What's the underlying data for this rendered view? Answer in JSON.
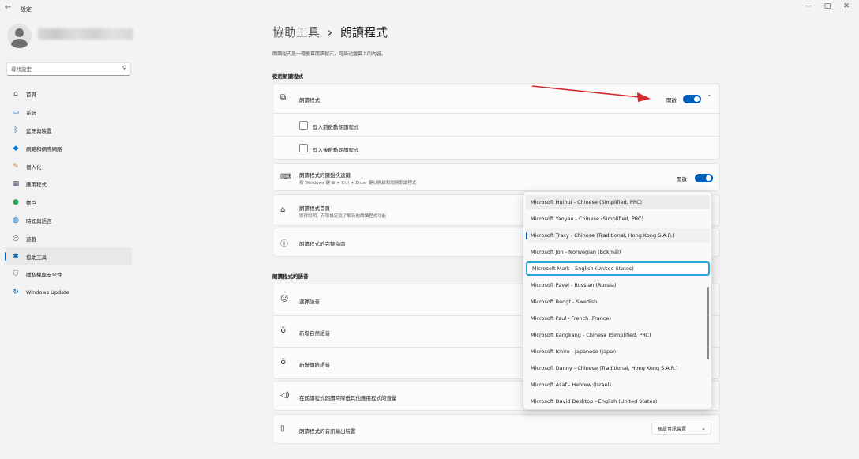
{
  "window": {
    "title": "設定",
    "controls": [
      "—",
      "▢",
      "✕"
    ]
  },
  "user": {
    "name": ""
  },
  "search": {
    "placeholder": "尋找設定"
  },
  "nav": [
    {
      "label": "首頁",
      "icon": "home-icon",
      "glyph": "⌂",
      "color": "#555555"
    },
    {
      "label": "系統",
      "icon": "system-icon",
      "glyph": "▭",
      "color": "#0067c0"
    },
    {
      "label": "藍牙與裝置",
      "icon": "bluetooth-icon",
      "glyph": "ᛒ",
      "color": "#0067c0"
    },
    {
      "label": "網路和網際網路",
      "icon": "network-icon",
      "glyph": "◆",
      "color": "#0078d4"
    },
    {
      "label": "個人化",
      "icon": "brush-icon",
      "glyph": "✎",
      "color": "#d87a1c"
    },
    {
      "label": "應用程式",
      "icon": "apps-icon",
      "glyph": "▦",
      "color": "#4a5568"
    },
    {
      "label": "帳戶",
      "icon": "account-icon",
      "glyph": "●",
      "color": "#2e9d5a"
    },
    {
      "label": "時間與語言",
      "icon": "globe-time-icon",
      "glyph": "◍",
      "color": "#0078d4"
    },
    {
      "label": "遊戲",
      "icon": "gamepad-icon",
      "glyph": "◎",
      "color": "#666666"
    },
    {
      "label": "協助工具",
      "icon": "accessibility-icon",
      "glyph": "✱",
      "color": "#0067c0",
      "active": true
    },
    {
      "label": "隱私權與安全性",
      "icon": "shield-icon",
      "glyph": "⛉",
      "color": "#707070"
    },
    {
      "label": "Windows Update",
      "icon": "update-icon",
      "glyph": "↻",
      "color": "#0078d4"
    }
  ],
  "breadcrumb": {
    "parent": "協助工具",
    "separator": "›",
    "current": "朗讀程式"
  },
  "description": "朗讀程式是一種螢幕閱讀程式，可描述螢幕上的內容。",
  "sections": {
    "use_narrator": "使用朗讀程式",
    "narrator_voice": "朗讀程式的語音"
  },
  "narrator": {
    "title": "朗讀程式",
    "state": "開啟"
  },
  "checkbox_before_signin": "登入前啟動朗讀程式",
  "checkbox_after_signin": "登入後啟動朗讀程式",
  "shortcut": {
    "title": "朗讀程式的鍵盤快速鍵",
    "subtitle": "按 Windows 鍵 ⊞ + Ctrl + Enter 鍵以開啟和關閉朗讀程式",
    "state": "開啟"
  },
  "home_row": {
    "title": "朗讀程式首頁",
    "subtitle": "取得說明、存取設定及了解新的朗讀程式功能"
  },
  "guide_row": {
    "title": "朗讀程式的完整指南"
  },
  "voice_rows": {
    "choose": "選擇語音",
    "natural": "新增自然語音",
    "legacy": "新增傳統語音",
    "lower_volume": "在朗讀程式朗讀時降低其他應用程式的音量",
    "audio_output": "朗讀程式的音訊輸出裝置"
  },
  "audio_output_value": "預設音訊裝置",
  "voices": [
    "Microsoft Huihui - Chinese (Simplified, PRC)",
    "Microsoft Yaoyao - Chinese (Simplified, PRC)",
    "Microsoft Tracy - Chinese (Traditional, Hong Kong S.A.R.)",
    "Microsoft Jon - Norwegian (Bokmål)",
    "Microsoft Mark - English (United States)",
    "Microsoft Pavel - Russian (Russia)",
    "Microsoft Bengt - Swedish",
    "Microsoft Paul - French (France)",
    "Microsoft Kangkang - Chinese (Simplified, PRC)",
    "Microsoft Ichiro - Japanese (Japan)",
    "Microsoft Danny - Chinese (Traditional, Hong Kong S.A.R.)",
    "Microsoft Asaf - Hebrew (Israel)",
    "Microsoft David Desktop - English (United States)"
  ],
  "voice_states": {
    "hover": 0,
    "selected": 2,
    "focused": 4
  },
  "colors": {
    "accent": "#005fb8",
    "focus_ring": "#28a8d8",
    "annotation_arrow": "#d42a2a"
  }
}
